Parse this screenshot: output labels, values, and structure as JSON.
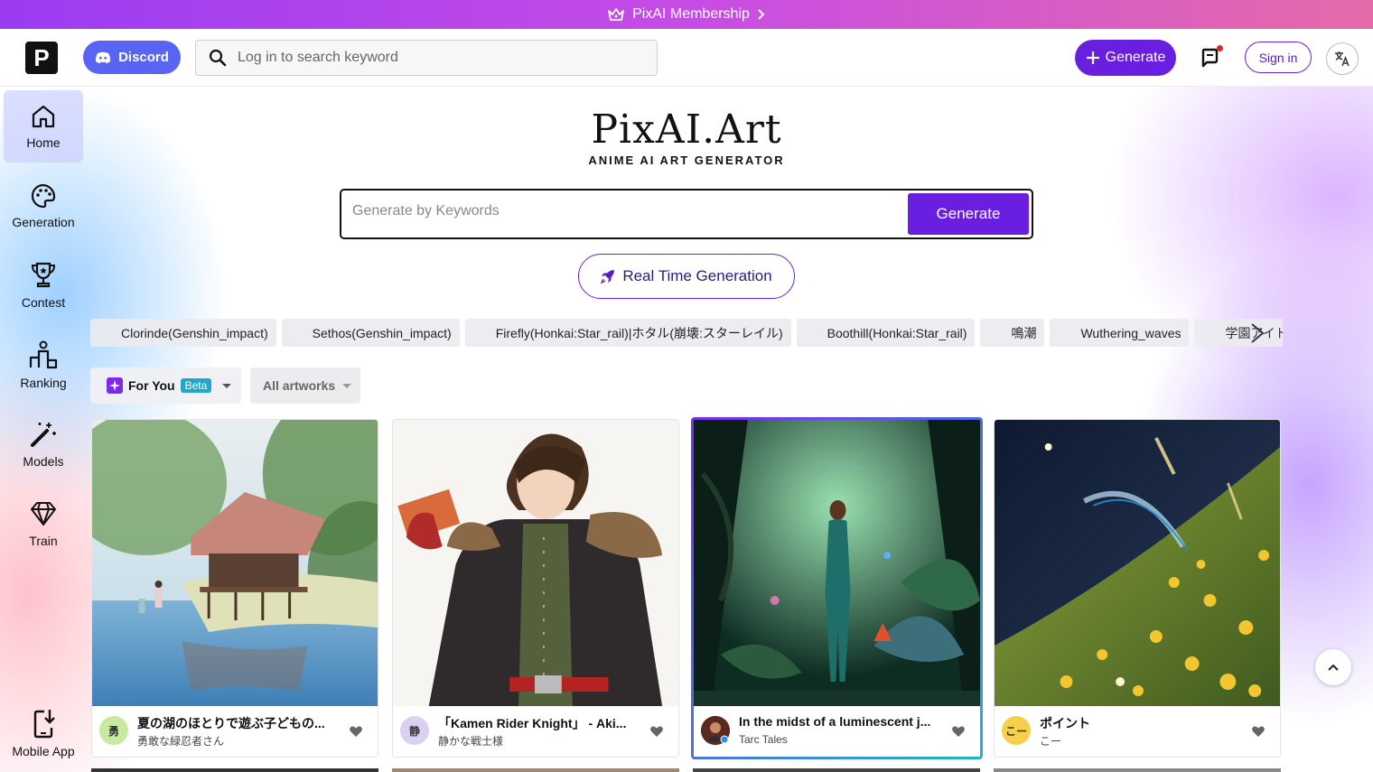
{
  "banner": {
    "text": "PixAI Membership"
  },
  "header": {
    "logo_letter": "P",
    "discord_label": "Discord",
    "search_placeholder": "Log in to search keyword",
    "generate_label": "Generate",
    "signin_label": "Sign in"
  },
  "sidebar": {
    "items": [
      {
        "label": "Home",
        "icon": "home-icon",
        "active": true
      },
      {
        "label": "Generation",
        "icon": "palette-icon"
      },
      {
        "label": "Contest",
        "icon": "trophy-icon"
      },
      {
        "label": "Ranking",
        "icon": "ranking-icon"
      },
      {
        "label": "Models",
        "icon": "magic-wand-icon"
      },
      {
        "label": "Train",
        "icon": "diamond-icon"
      }
    ],
    "mobile_app": "Mobile App"
  },
  "hero": {
    "title": "PixAI.Art",
    "subtitle": "ANIME AI ART GENERATOR",
    "input_placeholder": "Generate by Keywords",
    "generate_label": "Generate",
    "realtime_label": "Real Time Generation"
  },
  "tags": [
    "Clorinde(Genshin_impact)",
    "Sethos(Genshin_impact)",
    "Firefly(Honkai:Star_rail)|ホタル(崩壊:スターレイル)",
    "Boothill(Honkai:Star_rail)",
    "鳴潮",
    "Wuthering_waves",
    "学園アイドルマスター"
  ],
  "filters": {
    "for_you": "For You",
    "beta": "Beta",
    "all": "All artworks"
  },
  "cards": [
    {
      "title": "夏の湖のほとりで遊ぶ子どもの...",
      "author": "勇敢な緑忍者さん",
      "avatar_text": "勇",
      "avatar_color": "#c8eaa0",
      "highlight": false
    },
    {
      "title": "「Kamen Rider Knight」 - Aki...",
      "author": "静かな戦士様",
      "avatar_text": "静",
      "avatar_color": "#dcd0f2",
      "highlight": false
    },
    {
      "title": "In the midst of a luminescent j...",
      "author": "Tarc Tales",
      "avatar_text": "",
      "avatar_color": "#5a2a1e",
      "highlight": true
    },
    {
      "title": "ポイント",
      "author": "こー",
      "avatar_text": "こー",
      "avatar_color": "#f6d04a",
      "highlight": false
    }
  ],
  "colors": {
    "accent": "#6a1fe0",
    "discord": "#5865f2"
  }
}
